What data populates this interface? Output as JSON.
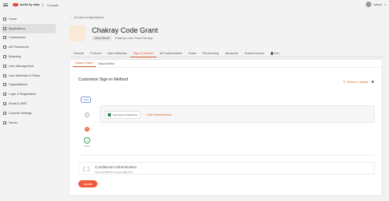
{
  "topbar": {
    "brand": "auth0 by okta",
    "product": "Console",
    "user_name": "admin"
  },
  "sidebar": {
    "items": [
      {
        "label": "Home",
        "icon": "home-icon"
      },
      {
        "label": "Applications",
        "icon": "apps-icon",
        "active": true
      },
      {
        "label": "Connections",
        "icon": "connections-icon"
      },
      {
        "label": "API Resources",
        "icon": "api-icon"
      },
      {
        "label": "Branding",
        "icon": "branding-icon",
        "expandable": true
      },
      {
        "label": "User Management",
        "icon": "users-icon",
        "expandable": true
      },
      {
        "label": "User Attributes & Roles",
        "icon": "attributes-icon",
        "expandable": true
      },
      {
        "label": "Organizations",
        "icon": "org-icon"
      },
      {
        "label": "Login & Registration",
        "icon": "login-icon"
      },
      {
        "label": "Email & SMS",
        "icon": "email-icon"
      },
      {
        "label": "Console Settings",
        "icon": "settings-icon"
      },
      {
        "label": "Server",
        "icon": "server-icon"
      }
    ]
  },
  "main": {
    "back_label": "Go back to Applications",
    "app_title": "Chakray Code Grant",
    "app_badge": "Client Secret",
    "app_desc": "Chakray Code Grant Test App",
    "tabs": [
      "General",
      "Protocol",
      "User Attributes",
      "Sign-In Method",
      "API Authorization",
      "Roles",
      "Provisioning",
      "Advanced",
      "Shared Access",
      "Info"
    ],
    "active_tab": "Sign-In Method"
  },
  "panel": {
    "subtabs": [
      "Classic Editor",
      "Visual Editor"
    ],
    "title": "Customize Sign-in Method",
    "reset_label": "Reset to default",
    "start_label": "Start",
    "step_number": "1",
    "authenticator_label": "Username & Password",
    "add_auth_label": "+ Add Authentication",
    "end_label": "Done",
    "conditional_title": "Conditional Authentication",
    "conditional_desc": "Add conditions to your login flow",
    "update_label": "Update"
  },
  "colors": {
    "accent": "#d8602e",
    "button": "#ef5b3e",
    "success": "#3aa757",
    "start_blue": "#4a6fc6"
  }
}
